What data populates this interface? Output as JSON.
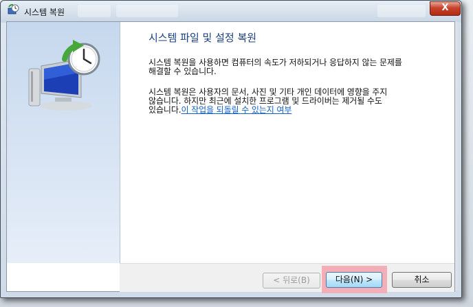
{
  "window": {
    "title": "시스템 복원",
    "close_label": "X"
  },
  "content": {
    "heading": "시스템 파일 및 설정 복원",
    "para1_line1": "시스템 복원을 사용하면 컴퓨터의 속도가 저하되거나 응답하지 않는 문제를",
    "para1_line2": "해결할 수 있습니다.",
    "para2_line1": "시스템 복원은 사용자의 문서, 사진 및 기타 개인 데이터에 영향을 주지",
    "para2_line2": "않습니다. 하지만 최근에 설치한 프로그램 및 드라이버는 제거될 수도",
    "para2_line3_prefix": "있습니다.",
    "para2_link": "이 작업을 되돌릴 수 있는지 여부"
  },
  "buttons": {
    "back": "< 뒤로(B)",
    "next": "다음(N) >",
    "cancel": "취소"
  },
  "icons": {
    "title": "system-restore-icon",
    "hero": "system-restore-clock-monitor-icon"
  },
  "colors": {
    "heading": "#1a3f80",
    "link": "#1060c8",
    "highlight": "#f4aeb8"
  }
}
